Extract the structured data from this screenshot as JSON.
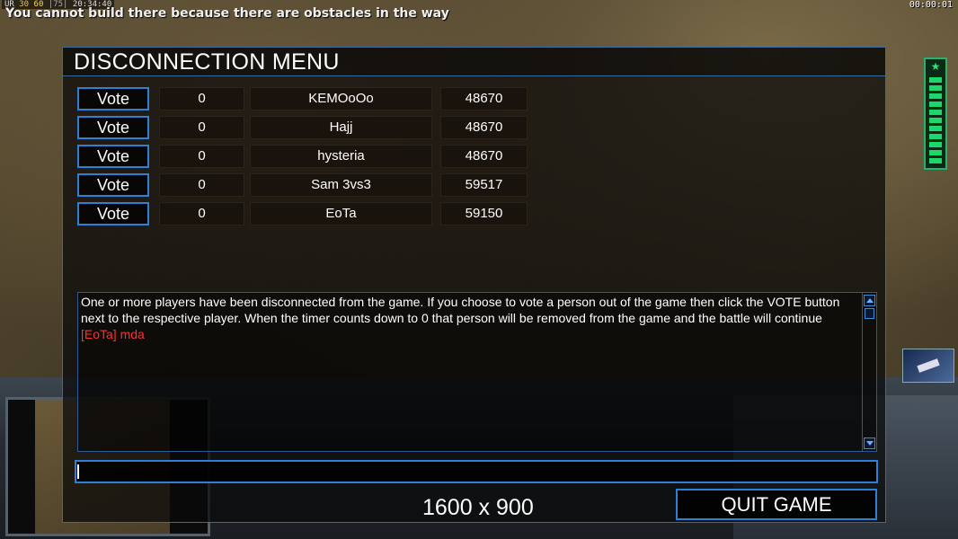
{
  "hud": {
    "ur_label": "UR",
    "num1": "30",
    "num2": "60",
    "num3": "|75|",
    "clock": "20:34:40",
    "message": "You cannot build there because there are obstacles in the way",
    "game_timer": "00:00:01"
  },
  "dialog": {
    "title": "DISCONNECTION MENU",
    "vote_label": "Vote",
    "players": [
      {
        "votes": "0",
        "name": "KEMOoOo",
        "value": "48670"
      },
      {
        "votes": "0",
        "name": "Hajj",
        "value": "48670"
      },
      {
        "votes": "0",
        "name": "hysteria",
        "value": "48670"
      },
      {
        "votes": "0",
        "name": "Sam 3vs3",
        "value": "59517"
      },
      {
        "votes": "0",
        "name": "EoTa",
        "value": "59150"
      }
    ],
    "info_text": "One or more players have been disconnected from the game. If you choose to vote a person out of the game then click the VOTE button next to the respective player. When the timer counts down to 0 that person will be removed from the game and the battle will continue",
    "chat_line": "[EoTa] mda",
    "chat_input_value": "",
    "resolution_text": "1600 x 900",
    "quit_label": "QUIT GAME"
  },
  "colors": {
    "accent_blue": "#2d7fd8",
    "chat_red": "#ff3030",
    "power_green": "#1ed66a"
  }
}
